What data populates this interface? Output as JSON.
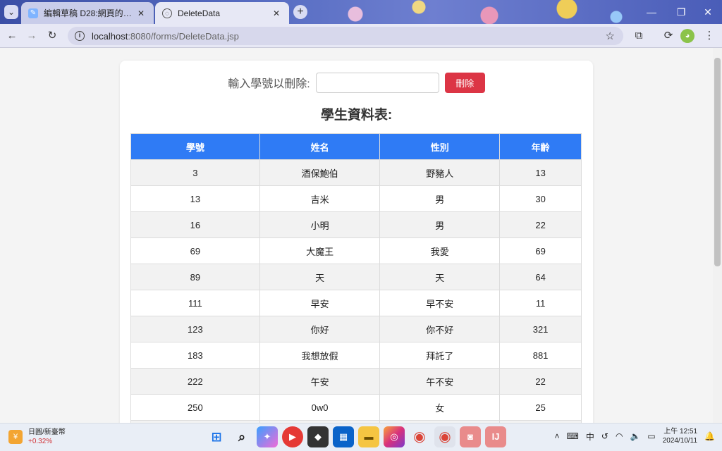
{
  "browser": {
    "tabs": [
      {
        "title": "編輯草稿 D28:網頁的美化效果",
        "active": false
      },
      {
        "title": "DeleteData",
        "active": true
      }
    ],
    "url_host": "localhost",
    "url_path": ":8080/forms/DeleteData.jsp"
  },
  "form": {
    "label": "輸入學號以刪除:",
    "input_value": "",
    "delete_button": "刪除"
  },
  "page": {
    "heading": "學生資料表:"
  },
  "table": {
    "headers": [
      "學號",
      "姓名",
      "性別",
      "年齡"
    ],
    "rows": [
      [
        "3",
        "酒保鮑伯",
        "野豬人",
        "13"
      ],
      [
        "13",
        "吉米",
        "男",
        "30"
      ],
      [
        "16",
        "小明",
        "男",
        "22"
      ],
      [
        "69",
        "大魔王",
        "我愛",
        "69"
      ],
      [
        "89",
        "天",
        "天",
        "64"
      ],
      [
        "111",
        "早安",
        "早不安",
        "11"
      ],
      [
        "123",
        "你好",
        "你不好",
        "321"
      ],
      [
        "183",
        "我想放假",
        "拜託了",
        "881"
      ],
      [
        "222",
        "午安",
        "午不安",
        "22"
      ],
      [
        "250",
        "0w0",
        "女",
        "25"
      ]
    ]
  },
  "taskbar": {
    "weather_title": "日圓/新臺幣",
    "weather_change": "+0.32%",
    "ime": "中",
    "time": "上午 12:51",
    "date": "2024/10/11"
  },
  "colors": {
    "header_blue": "#2f7bf5",
    "delete_red": "#dc3545"
  }
}
